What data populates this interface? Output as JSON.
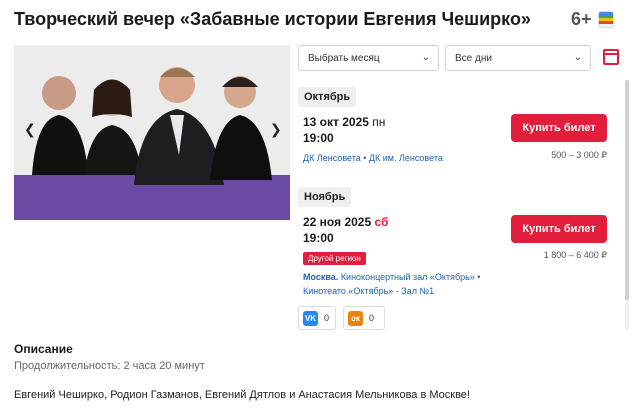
{
  "event": {
    "title": "Творческий вечер «Забавные истории Евгения Чеширко»",
    "age": "6+"
  },
  "filters": {
    "month_label": "Выбрать месяц",
    "days_label": "Все дни"
  },
  "sessions": [
    {
      "month": "Октябрь",
      "date": "13 окт 2025",
      "weekday": "пн",
      "time": "19:00",
      "venue": "ДК Ленсовета • ДК им. Ленсовета",
      "buy_label": "Купить билет",
      "price": "500 – 3 000 ₽"
    },
    {
      "month": "Ноябрь",
      "date": "22 ноя 2025",
      "weekday": "сб",
      "time": "19:00",
      "badge": "Другой регион",
      "venue_city": "Москва.",
      "venue_line1": " Киноконцертный зал «Октябрь» •",
      "venue_line2": "Кинотеато «Октябрь» - Зал №1",
      "buy_label": "Купить билет",
      "price": "1 800 – 6 400 ₽"
    }
  ],
  "share": {
    "vk_label": "VK",
    "vk_count": "0",
    "ok_label": "ок",
    "ok_count": "0"
  },
  "description": {
    "heading": "Описание",
    "duration": "Продолжительность: 2 часа 20 минут",
    "text": "Евгений Чеширко, Родион Газманов, Евгений Дятлов и Анастасия Мельникова в Москве!"
  },
  "colors": {
    "accent": "#e21e3c",
    "link": "#1f63b5",
    "banner_band": "#6b4aa3"
  },
  "icons": [
    "wallet-icon",
    "calendar-icon",
    "chevron-left-icon",
    "chevron-right-icon",
    "chevron-down-icon",
    "vk-icon",
    "ok-icon"
  ]
}
